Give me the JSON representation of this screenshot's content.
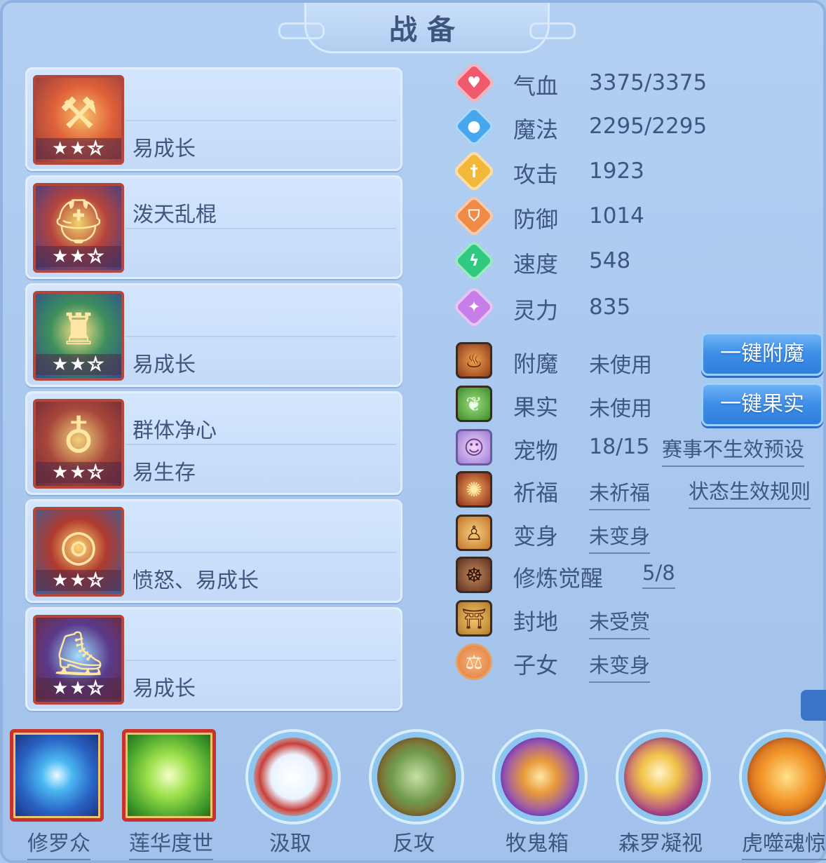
{
  "title": "战备",
  "equipment": [
    {
      "top": "",
      "bottom": "易成长",
      "stars": "★★",
      "stars_off": "☆"
    },
    {
      "top": "泼天乱棍",
      "bottom": "",
      "stars": "★★",
      "stars_off": "☆"
    },
    {
      "top": "",
      "bottom": "易成长",
      "stars": "★★",
      "stars_off": "☆"
    },
    {
      "top": "群体净心",
      "bottom": "易生存",
      "stars": "★★",
      "stars_off": "☆"
    },
    {
      "top": "",
      "bottom": "愤怒、易成长",
      "stars": "★★",
      "stars_off": "☆"
    },
    {
      "top": "",
      "bottom": "易成长",
      "stars": "★★",
      "stars_off": "☆"
    }
  ],
  "stats": [
    {
      "label": "气血",
      "value": "3375/3375",
      "icon": "heart-icon",
      "color": "#ef5a6f"
    },
    {
      "label": "魔法",
      "value": "2295/2295",
      "icon": "mana-icon",
      "color": "#46a6ee"
    },
    {
      "label": "攻击",
      "value": "1923",
      "icon": "sword-icon",
      "color": "#f3b73a"
    },
    {
      "label": "防御",
      "value": "1014",
      "icon": "shield-icon",
      "color": "#f08a47"
    },
    {
      "label": "速度",
      "value": "548",
      "icon": "lightning-icon",
      "color": "#2fc981"
    },
    {
      "label": "灵力",
      "value": "835",
      "icon": "spirit-icon",
      "color": "#c87ee8"
    }
  ],
  "extras": {
    "enchant": {
      "label": "附魔",
      "value": "未使用",
      "button": "一键附魔"
    },
    "fruit": {
      "label": "果实",
      "value": "未使用",
      "button": "一键果实"
    },
    "pet": {
      "label": "宠物",
      "value": "18/15",
      "link": "赛事不生效预设"
    },
    "bless": {
      "label": "祈福",
      "value": "未祈福",
      "link": "状态生效规则"
    },
    "transform": {
      "label": "变身",
      "value": "未变身"
    },
    "awaken": {
      "label": "修炼觉醒",
      "value": "5/8"
    },
    "fief": {
      "label": "封地",
      "value": "未受赏"
    },
    "children": {
      "label": "子女",
      "value": "未变身"
    }
  },
  "skills": [
    {
      "name": "修罗众"
    },
    {
      "name": "莲华度世"
    },
    {
      "name": "汲取"
    },
    {
      "name": "反攻"
    },
    {
      "name": "牧鬼箱"
    },
    {
      "name": "森罗凝视"
    },
    {
      "name": "虎噬魂惊"
    }
  ]
}
